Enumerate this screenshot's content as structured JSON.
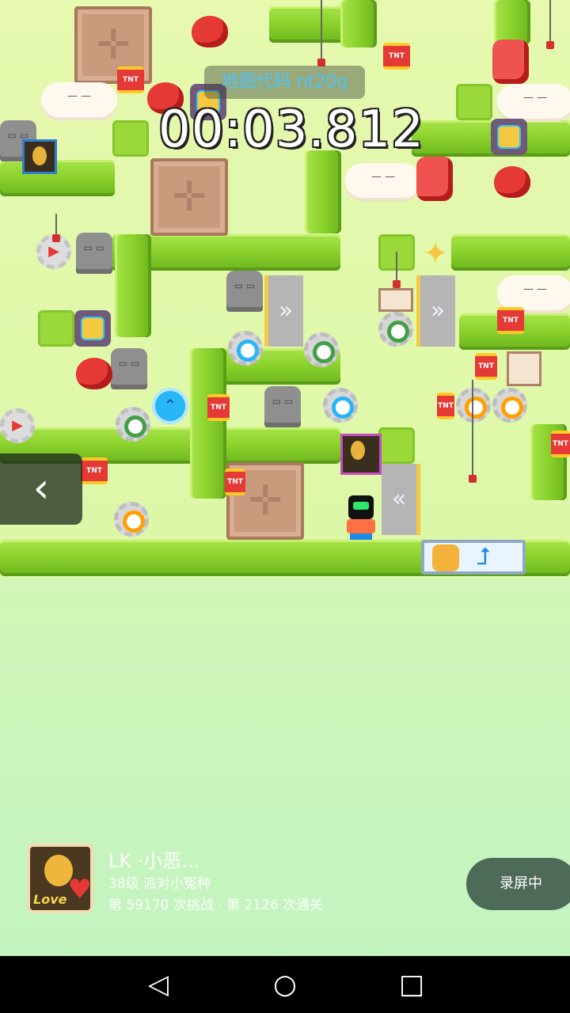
{
  "hud": {
    "map_code": "地图代码 nt20q",
    "timer": "00:03.812"
  },
  "game": {
    "tnt_label": "TNT",
    "goal_icon": "arrow-up-right-icon",
    "back_icon": "chevron-left-icon"
  },
  "player": {
    "name": "LK ·小恶...",
    "level": "38级 派对小冤种",
    "stats": "第 59170 次挑战 · 第 2126 次通关",
    "avatar_text": "Love"
  },
  "record_button": "录屏中",
  "navbar": {
    "back_icon": "◁",
    "home_icon": "○",
    "recents_icon": "□"
  },
  "colors": {
    "pipe_green": "#8ad12c",
    "background": "#d2f6b6",
    "map_code_text": "#4fc3f7",
    "tnt_red": "#e53935",
    "record_button_bg": "#4e6a58"
  }
}
